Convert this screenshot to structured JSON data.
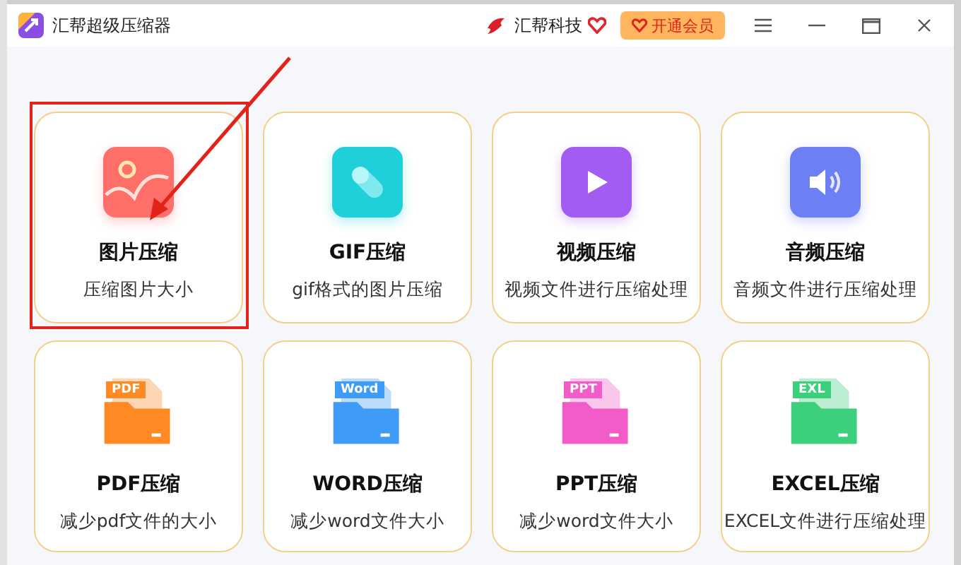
{
  "window": {
    "title": "汇帮超级压缩器",
    "brand": "汇帮科技",
    "vip_button": "开通会员"
  },
  "tools": [
    {
      "kind": "image",
      "title": "图片压缩",
      "description": "压缩图片大小",
      "color": "#ff6f6a",
      "highlighted": true
    },
    {
      "kind": "gif",
      "title": "GIF压缩",
      "description": "gif格式的图片压缩",
      "color": "#1fcfd9",
      "highlighted": false
    },
    {
      "kind": "video",
      "title": "视频压缩",
      "description": "视频文件进行压缩处理",
      "color": "#a35cf2",
      "highlighted": false
    },
    {
      "kind": "audio",
      "title": "音频压缩",
      "description": "音频文件进行压缩处理",
      "color": "#6c7ff5",
      "highlighted": false
    },
    {
      "kind": "file",
      "tag": "PDF",
      "title": "PDF压缩",
      "description": "减少pdf文件的大小",
      "color": "#ff8a24",
      "highlighted": false
    },
    {
      "kind": "file",
      "tag": "Word",
      "title": "WORD压缩",
      "description": "减少word文件大小",
      "color": "#3f9cf6",
      "highlighted": false
    },
    {
      "kind": "file",
      "tag": "PPT",
      "title": "PPT压缩",
      "description": "减少word文件大小",
      "color": "#f25cc9",
      "highlighted": false
    },
    {
      "kind": "file",
      "tag": "EXL",
      "title": "EXCEL压缩",
      "description": "EXCEL文件进行压缩处理",
      "color": "#3ccf7c",
      "highlighted": false
    }
  ]
}
